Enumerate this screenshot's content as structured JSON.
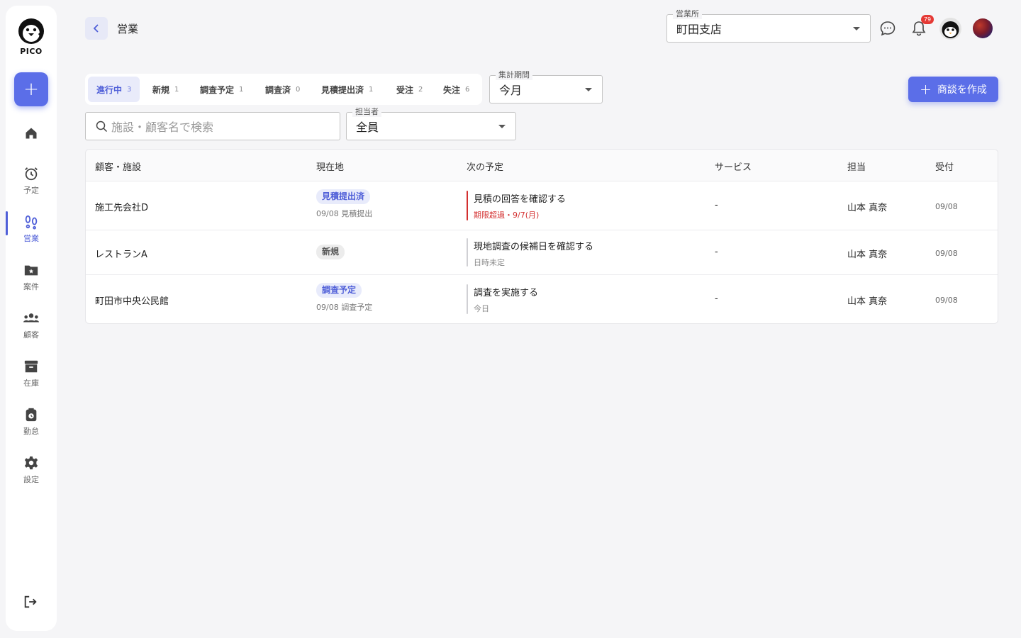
{
  "sidebar": {
    "logo_text": "PICO",
    "fab_label": "+",
    "items": [
      {
        "label": ""
      },
      {
        "label": "予定"
      },
      {
        "label": "営業"
      },
      {
        "label": "案件"
      },
      {
        "label": "顧客"
      },
      {
        "label": "在庫"
      },
      {
        "label": "勤怠"
      },
      {
        "label": "設定"
      }
    ]
  },
  "header": {
    "title": "営業",
    "office": {
      "legend": "営業所",
      "value": "町田支店"
    },
    "notification_count": "79"
  },
  "tabs": [
    {
      "label": "進行中",
      "count": "3"
    },
    {
      "label": "新規",
      "count": "1"
    },
    {
      "label": "調査予定",
      "count": "1"
    },
    {
      "label": "調査済",
      "count": "0"
    },
    {
      "label": "見積提出済",
      "count": "1"
    },
    {
      "label": "受注",
      "count": "2"
    },
    {
      "label": "失注",
      "count": "6"
    }
  ],
  "period": {
    "legend": "集計期間",
    "value": "今月"
  },
  "create_button": {
    "label": "商談を作成"
  },
  "search": {
    "placeholder": "施設・顧客名で検索"
  },
  "assignee": {
    "legend": "担当者",
    "value": "全員"
  },
  "table": {
    "headers": [
      "顧客・施設",
      "現在地",
      "次の予定",
      "サービス",
      "担当",
      "受付"
    ],
    "rows": [
      {
        "customer": "施工先会社D",
        "status": "見積提出済",
        "status_sub": "09/08 見積提出",
        "next_title": "見積の回答を確認する",
        "next_sub": "期限超過・9/7(月)",
        "service": "-",
        "owner": "山本 真奈",
        "date": "09/08"
      },
      {
        "customer": "レストランA",
        "status": "新規",
        "status_sub": "",
        "next_title": "現地調査の候補日を確認する",
        "next_sub": "日時未定",
        "service": "-",
        "owner": "山本 真奈",
        "date": "09/08"
      },
      {
        "customer": "町田市中央公民館",
        "status": "調査予定",
        "status_sub": "09/08 調査予定",
        "next_title": "調査を実施する",
        "next_sub": "今日",
        "service": "-",
        "owner": "山本 真奈",
        "date": "09/08"
      }
    ]
  },
  "colors": {
    "accent": "#5b6ee8",
    "overdue": "#d32f2f"
  }
}
